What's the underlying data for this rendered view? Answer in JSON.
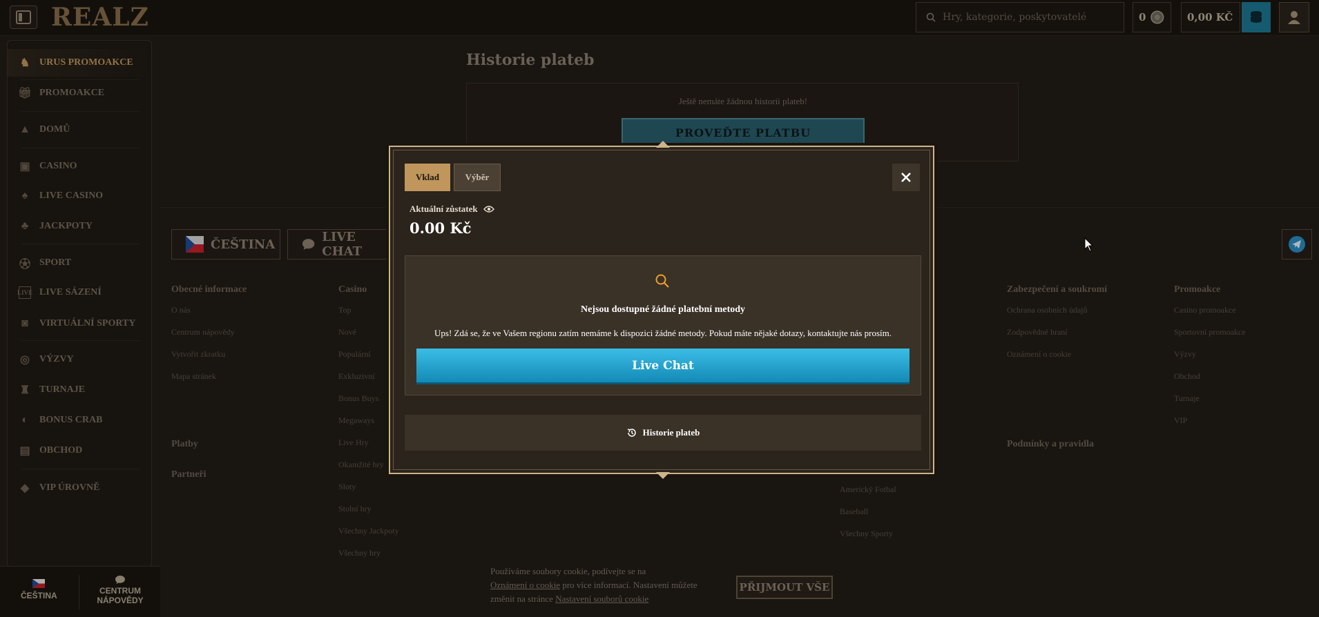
{
  "header": {
    "logo": "REALZ",
    "search_placeholder": "Hry, kategorie, poskytovatelé",
    "coins": "0",
    "balance": "0,00 KČ"
  },
  "sidebar": {
    "items": [
      {
        "label": "URUS PROMOAKCE",
        "icon": "bull-icon"
      },
      {
        "label": "PROMOAKCE",
        "icon": "gift-icon"
      },
      {
        "label": "DOMŮ",
        "icon": "home-icon"
      },
      {
        "label": "CASINO",
        "icon": "slot-icon"
      },
      {
        "label": "LIVE CASINO",
        "icon": "card-icon"
      },
      {
        "label": "JACKPOTY",
        "icon": "clover-icon"
      },
      {
        "label": "SPORT",
        "icon": "ball-icon"
      },
      {
        "label": "LIVE SÁZENÍ",
        "icon": "live-icon"
      },
      {
        "label": "VIRTUÁLNÍ SPORTY",
        "icon": "vr-icon"
      },
      {
        "label": "VÝZVY",
        "icon": "target-icon"
      },
      {
        "label": "TURNAJE",
        "icon": "trophy-icon"
      },
      {
        "label": "BONUS CRAB",
        "icon": "crab-icon"
      },
      {
        "label": "OBCHOD",
        "icon": "bag-icon"
      },
      {
        "label": "VIP ÚROVNĚ",
        "icon": "diamond-icon"
      }
    ],
    "bottom": {
      "language": "ČEŠTINA",
      "help_line1": "CENTRUM",
      "help_line2": "NÁPOVĚDY"
    }
  },
  "page": {
    "title": "Historie plateb",
    "empty_text": "Ještě nemáte žádnou historii plateb!",
    "make_payment": "PROVEĎTE PLATBU"
  },
  "footer": {
    "language_button": "ČEŠTINA",
    "chat_button": "LIVE CHAT",
    "col_general": {
      "title": "Obecné informace",
      "links": [
        "O nás",
        "Centrum nápovědy",
        "Vytvořit zkratku",
        "Mapa stránek"
      ]
    },
    "col_casino": {
      "title": "Casino",
      "links": [
        "Top",
        "Nové",
        "Populární",
        "Exkluzivní",
        "Bonus Buys",
        "Megaways",
        "Live Hry",
        "Okamžité hry",
        "Sloty",
        "Stolní hry",
        "Všechny Jackpoty",
        "Všechny hry"
      ]
    },
    "col_sport_links": [
      "Americký Fotbal",
      "Baseball",
      "Všechny Sporty"
    ],
    "col_security": {
      "title": "Zabezpečení a soukromí",
      "links": [
        "Ochrana osobních údajů",
        "Zodpovědné hraní",
        "Oznámení o cookie"
      ]
    },
    "col_promo": {
      "title": "Promoakce",
      "links": [
        "Casino promoakce",
        "Sportovní promoakce",
        "Výzvy",
        "Obchod",
        "Turnaje",
        "VIP"
      ]
    },
    "payments": "Platby",
    "partners": "Partneři",
    "terms": "Podmínky a pravidla"
  },
  "cookie": {
    "line1": "Používáme soubory cookie, podívejte se na",
    "link1": "Oznámení o cookie",
    "line2": "pro více informací. Nastavení můžete",
    "line3": "změnit na stránce",
    "link2": "Nastavení souborů cookie",
    "accept": "PŘIJMOUT VŠE"
  },
  "modal": {
    "tab_deposit": "Vklad",
    "tab_withdraw": "Výběr",
    "balance_label": "Aktuální zůstatek",
    "balance_value": "0.00 Kč",
    "no_methods_title": "Nejsou dostupné žádné platební metody",
    "no_methods_text": "Ups! Zdá se, že ve Vašem regionu zatím nemáme k dispozici žádné metody. Pokud máte nějaké dotazy, kontaktujte nás prosím.",
    "live_chat": "Live Chat",
    "history": "Historie plateb"
  },
  "colors": {
    "accent": "#c0965d",
    "chat_blue": "#1f9fcb",
    "background": "#221d17"
  }
}
